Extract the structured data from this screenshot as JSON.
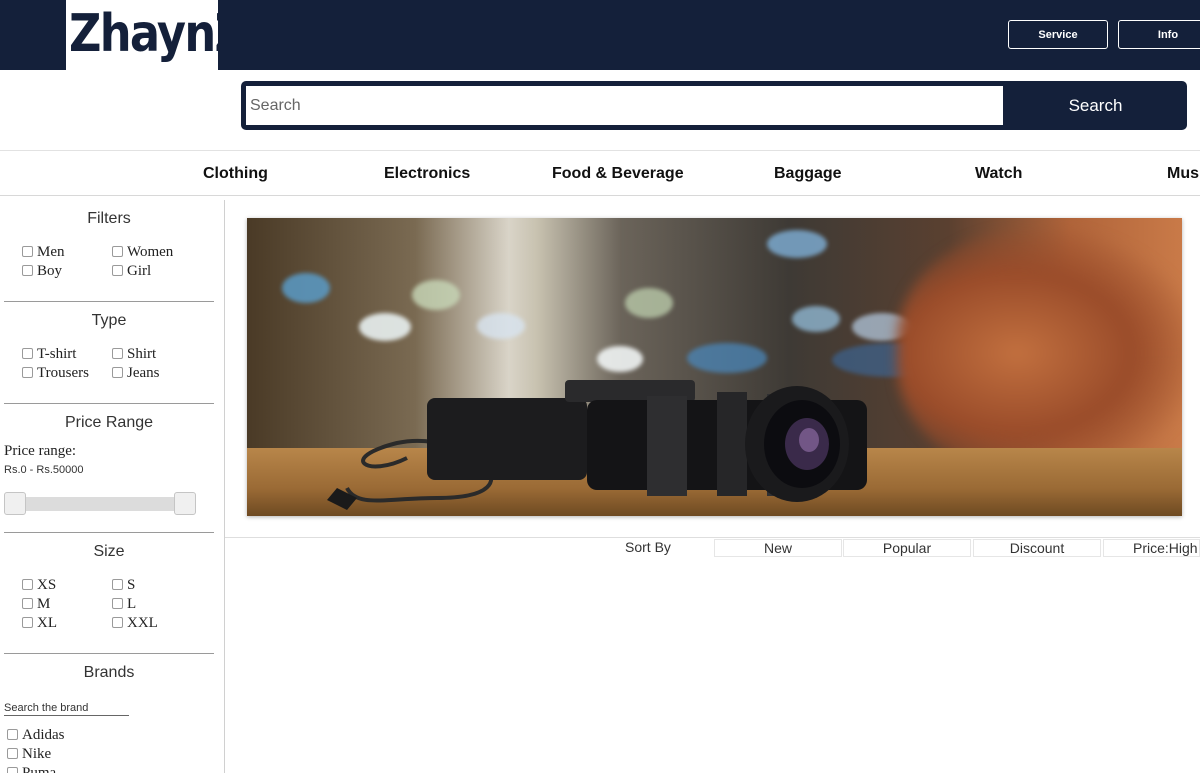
{
  "header": {
    "logo_text": "ZhaynZ",
    "buttons": {
      "service": "Service",
      "info": "Info"
    },
    "brand_color": "#14203a"
  },
  "search": {
    "placeholder": "Search",
    "value": "",
    "button_label": "Search"
  },
  "categories": [
    "Clothing",
    "Electronics",
    "Food & Beverage",
    "Baggage",
    "Watch",
    "Mus"
  ],
  "sidebar": {
    "filters": {
      "title": "Filters",
      "options": [
        "Men",
        "Women",
        "Boy",
        "Girl"
      ]
    },
    "type": {
      "title": "Type",
      "options": [
        "T-shirt",
        "Shirt",
        "Trousers",
        "Jeans"
      ]
    },
    "price": {
      "title": "Price Range",
      "label": "Price range:",
      "range_text": "Rs.0 - Rs.50000",
      "min": 0,
      "max": 50000,
      "selected_min": 0,
      "selected_max": 50000
    },
    "size": {
      "title": "Size",
      "options": [
        "XS",
        "S",
        "M",
        "L",
        "XL",
        "XXL"
      ]
    },
    "brands": {
      "title": "Brands",
      "search_placeholder": "Search the brand",
      "options": [
        "Adidas",
        "Nike",
        "Puma"
      ]
    }
  },
  "banner": {
    "icon": "camera-photo"
  },
  "sort": {
    "label": "Sort By",
    "options": [
      "New",
      "Popular",
      "Discount",
      "Price:High"
    ]
  }
}
